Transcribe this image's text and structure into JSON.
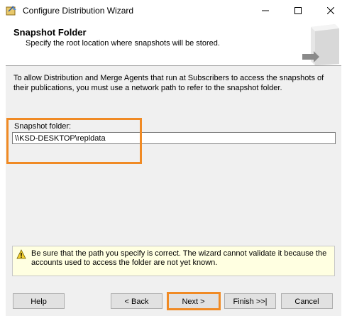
{
  "window": {
    "title": "Configure Distribution Wizard",
    "controls": [
      "minimize-icon",
      "maximize-icon",
      "close-icon"
    ]
  },
  "header": {
    "title": "Snapshot Folder",
    "subtitle": "Specify the root location where snapshots will be stored."
  },
  "main": {
    "intro": "To allow Distribution and Merge Agents that run at Subscribers to access the snapshots of their publications, you must use a network path to refer to the snapshot folder.",
    "snapshot_folder_label": "Snapshot folder:",
    "snapshot_folder_value": "\\\\KSD-DESKTOP\\repldata",
    "warning_text": "Be sure that the path you specify is correct. The wizard cannot validate it because the accounts used to access the folder are not yet known."
  },
  "footer": {
    "help": "Help",
    "back": "< Back",
    "next": "Next >",
    "finish": "Finish >>|",
    "cancel": "Cancel"
  },
  "colors": {
    "highlight": "#f08a24",
    "warning_bg": "#ffffe1",
    "panel_bg": "#f0f0f0"
  }
}
